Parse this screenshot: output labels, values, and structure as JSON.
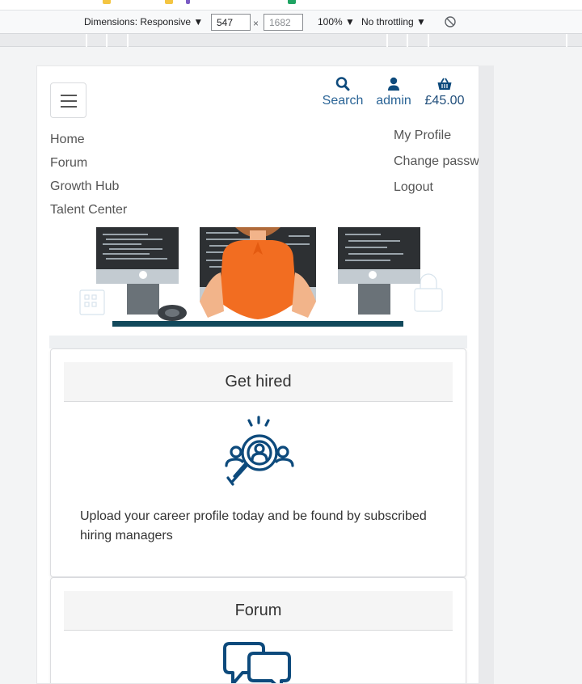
{
  "devtools": {
    "dimensions_label": "Dimensions: Responsive",
    "width_value": "547",
    "height_value": "1682",
    "zoom": "100%",
    "throttling": "No throttling",
    "times": "×"
  },
  "header": {
    "search_label": "Search",
    "account_label": "admin",
    "basket_total": "£45.00",
    "icons": [
      "search-icon",
      "user-icon",
      "basket-icon"
    ]
  },
  "nav": {
    "main": [
      "Home",
      "Forum",
      "Growth Hub",
      "Talent Center"
    ],
    "account": [
      "My Profile",
      "Change password",
      "Logout"
    ]
  },
  "cards": [
    {
      "title": "Get hired",
      "icon": "search-people-icon",
      "text": "Upload your career profile today and be found by subscribed hiring managers"
    },
    {
      "title": "Forum",
      "icon": "chat-bubbles-icon",
      "text": ""
    }
  ],
  "colors": {
    "brand_blue": "#0d4a7c",
    "link_blue": "#2a6496",
    "hero_orange": "#f26d21"
  }
}
